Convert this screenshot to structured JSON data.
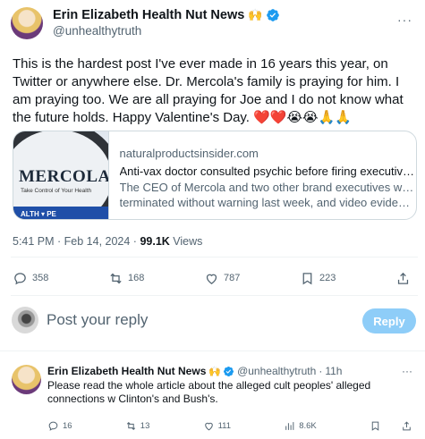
{
  "post": {
    "author_name": "Erin Elizabeth Health Nut News",
    "name_emoji": "🙌",
    "handle": "@unhealthytruth",
    "text": "This is the hardest post I've ever made in 16 years this year, on Twitter or anywhere else. Dr. Mercola's family is praying for him.  I am praying too. We are all praying for Joe and I do not know what the future holds. Happy Valentine's Day. ❤️❤️😭😭🙏🙏",
    "timestamp": "5:41 PM · Feb 14, 2024 · ",
    "views_count": "99.1K",
    "views_label": " Views"
  },
  "link_card": {
    "thumb_brand": "MERCOLA",
    "thumb_tagline": "Take Control of Your Health",
    "thumb_strip": "ALTH ▾    PE",
    "domain": "naturalproductsinsider.com",
    "title": "Anti-vax doctor consulted psychic before firing executives after brand probe",
    "description_line1": "The CEO of Mercola and two other brand executives were",
    "description_line2": "terminated without warning last week, and video evidence suggests"
  },
  "actions": {
    "replies": "358",
    "reposts": "168",
    "likes": "787",
    "bookmarks": "223"
  },
  "composer": {
    "placeholder": "Post your reply",
    "reply_button": "Reply"
  },
  "reply": {
    "author_name": "Erin Elizabeth Health Nut News",
    "name_emoji": "🙌",
    "handle": "@unhealthytruth",
    "separator": "·",
    "time": "11h",
    "text": "Please read the whole article about the alleged cult peoples' alleged connections w Clinton's and Bush's.",
    "replies": "16",
    "reposts": "13",
    "likes": "111",
    "views": "8.6K"
  },
  "colors": {
    "verified": "#1d9bf0",
    "secondary_text": "#536471",
    "reply_button_bg": "#8ecdf8"
  }
}
